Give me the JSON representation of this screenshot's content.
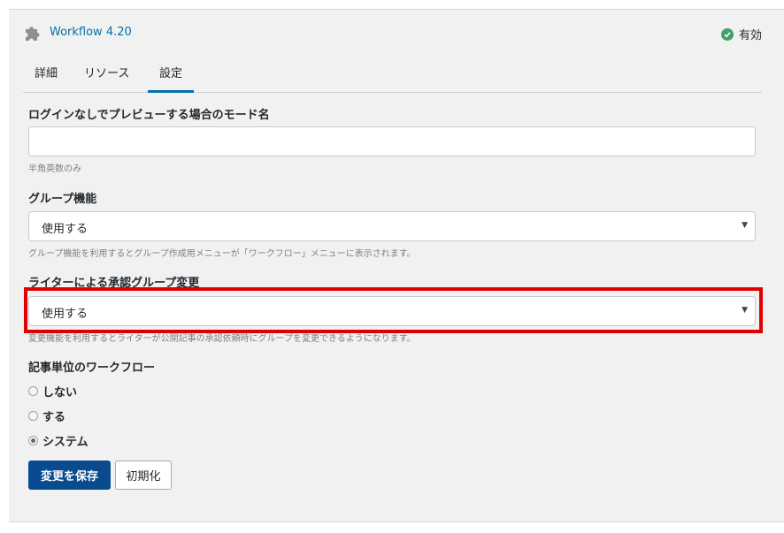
{
  "header": {
    "plugin_title": "Workflow 4.20",
    "status_label": "有効",
    "plugin_icon": "puzzle-icon",
    "status_icon": "check-circle-icon",
    "status_color": "#43a06a"
  },
  "tabs": [
    {
      "label": "詳細",
      "active": false
    },
    {
      "label": "リソース",
      "active": false
    },
    {
      "label": "設定",
      "active": true
    }
  ],
  "form": {
    "preview_mode": {
      "label": "ログインなしでプレビューする場合のモード名",
      "value": "",
      "help": "半角英数のみ"
    },
    "group_feature": {
      "label": "グループ機能",
      "value": "使用する",
      "help": "グループ機能を利用するとグループ作成用メニューが「ワークフロー」メニューに表示されます。"
    },
    "writer_group_change": {
      "label": "ライターによる承認グループ変更",
      "value": "使用する",
      "help": "変更機能を利用するとライターが公開記事の承認依頼時にグループを変更できるようになります。"
    },
    "article_workflow": {
      "label": "記事単位のワークフロー",
      "options": [
        {
          "label": "しない",
          "checked": false
        },
        {
          "label": "する",
          "checked": false
        },
        {
          "label": "システム",
          "checked": true
        }
      ]
    }
  },
  "buttons": {
    "save_label": "変更を保存",
    "reset_label": "初期化"
  },
  "colors": {
    "accent": "#0073aa",
    "primary_button": "#0a4b8f",
    "highlight_border": "#e00000"
  }
}
